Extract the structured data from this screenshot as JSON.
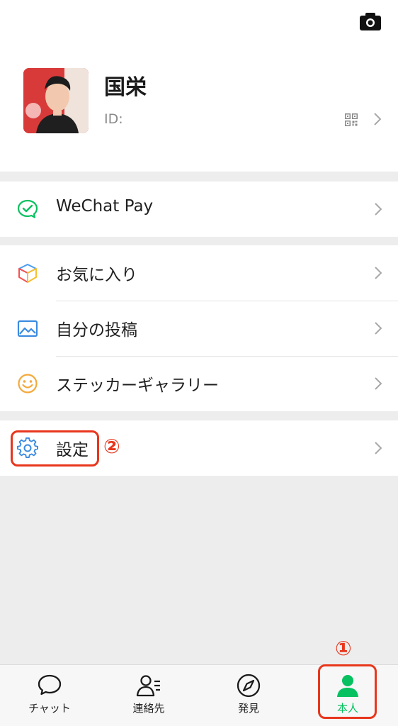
{
  "profile": {
    "name": "国栄",
    "id_label": "ID:"
  },
  "menu": {
    "pay": "WeChat Pay",
    "favorites": "お気に入り",
    "posts": "自分の投稿",
    "stickers": "ステッカーギャラリー",
    "settings": "設定"
  },
  "tabs": [
    {
      "label": "チャット",
      "icon": "chat-bubble-icon"
    },
    {
      "label": "連絡先",
      "icon": "contacts-icon"
    },
    {
      "label": "発見",
      "icon": "compass-icon"
    },
    {
      "label": "本人",
      "icon": "person-icon"
    }
  ],
  "annotations": {
    "step1": "①",
    "step2": "②"
  },
  "colors": {
    "accent_green": "#07c160",
    "callout_red": "#e8361c",
    "background": "#ededed"
  }
}
